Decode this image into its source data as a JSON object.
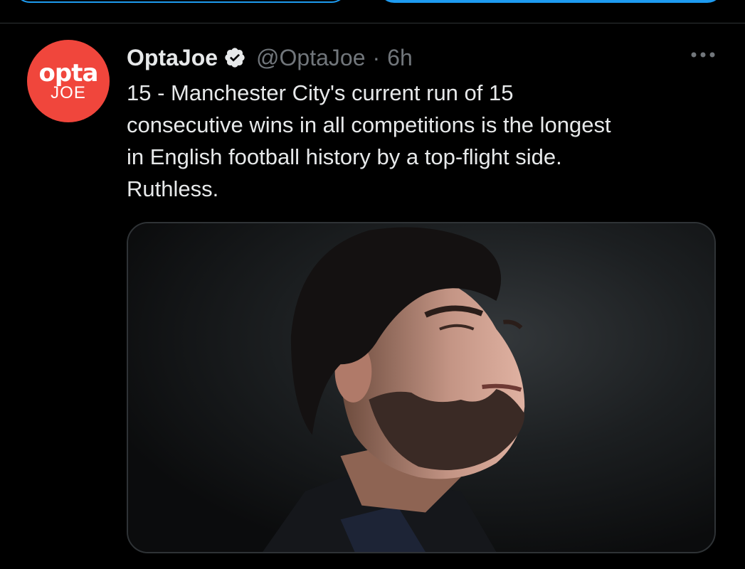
{
  "tweet": {
    "avatar": {
      "logo_top": "opta",
      "logo_bottom": "JOE",
      "color": "#f0463c"
    },
    "display_name": "OptaJoe",
    "verified_icon": "verified-badge-icon",
    "handle": "@OptaJoe",
    "separator": "·",
    "time": "6h",
    "more_icon": "more-options-icon",
    "text": "15 - Manchester City's current run of 15\nconsecutive wins in all competitions is the longest\nin English football history by a top-flight side.\nRuthless.",
    "media": {
      "description_icon": "photo-icon"
    }
  },
  "colors": {
    "background": "#000000",
    "accent": "#1d9bf0",
    "text_primary": "#e7e9ea",
    "text_secondary": "#71767b",
    "divider": "#2f3336"
  }
}
